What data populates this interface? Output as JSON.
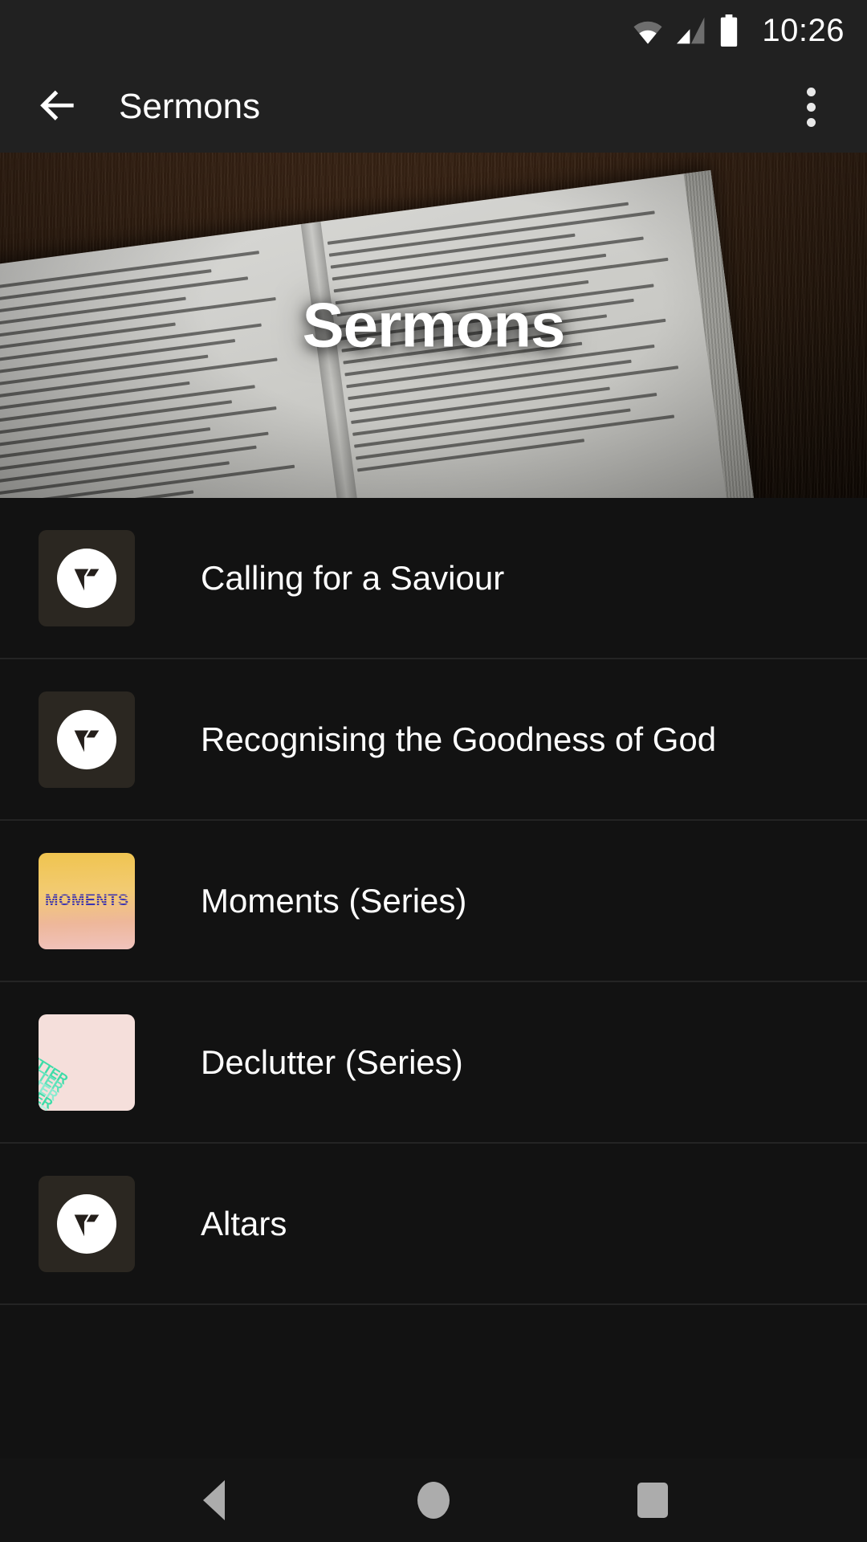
{
  "status_bar": {
    "time": "10:26",
    "icons": [
      "wifi-icon",
      "cell-signal-icon",
      "battery-icon"
    ]
  },
  "app_bar": {
    "back_icon": "arrow-back-icon",
    "title": "Sermons",
    "overflow_icon": "more-vert-icon"
  },
  "hero": {
    "overlay_title": "Sermons",
    "image_description": "open-bible-on-dark-wood"
  },
  "list": {
    "items": [
      {
        "title": "Calling for a Saviour",
        "thumb_type": "logo",
        "thumb_label": ""
      },
      {
        "title": "Recognising the Goodness of God",
        "thumb_type": "logo",
        "thumb_label": ""
      },
      {
        "title": "Moments (Series)",
        "thumb_type": "moments",
        "thumb_label": "MOMENTS"
      },
      {
        "title": "Declutter (Series)",
        "thumb_type": "declutter",
        "thumb_label": "DECLUTTER"
      },
      {
        "title": "Altars",
        "thumb_type": "logo",
        "thumb_label": ""
      }
    ]
  },
  "nav_bar": {
    "back_label": "Back",
    "home_label": "Home",
    "recents_label": "Recents"
  },
  "colors": {
    "background": "#121212",
    "bar_background": "#212121",
    "divider": "#242424",
    "text_primary": "#ffffff",
    "nav_icon": "#acacac",
    "moments_accent": "#3b32b4",
    "moments_bg": "#f0c44f",
    "declutter_accent": "#3ddca8",
    "declutter_bg": "#f5dfdb",
    "thumb_logo_bg": "#2b2721"
  }
}
